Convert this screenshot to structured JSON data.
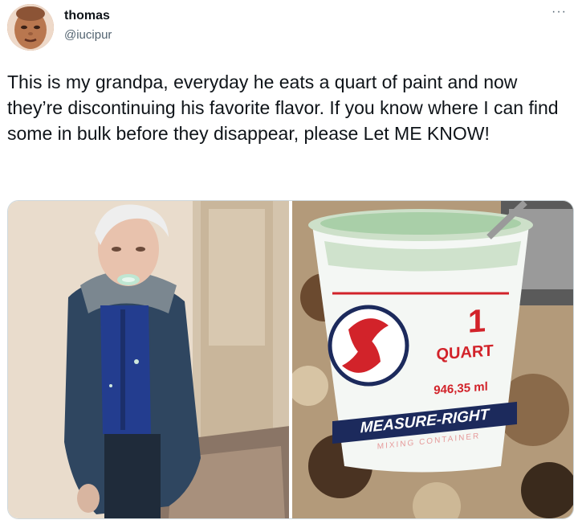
{
  "tweet": {
    "display_name": "thomas",
    "handle": "@iucipur",
    "more_label": "···",
    "text": "This is my grandpa, everyday he eats a quart of paint and now they’re discontinuing his favorite flavor. If you know where I can find some in bulk before they disappear, please Let ME KNOW!"
  },
  "media": {
    "photos": [
      {
        "name": "grandpa-photo"
      },
      {
        "name": "paint-bucket-photo",
        "label_number": "1",
        "label_unit": "QUART",
        "label_volume": "946,35 ml",
        "brand": "MEASURE-RIGHT",
        "sub_text": "MIXING CONTAINER"
      }
    ]
  },
  "colors": {
    "text": "#0f1419",
    "secondary": "#536471",
    "paint": "#a9cfa8",
    "label_red": "#d2232a",
    "label_navy": "#1c2a5c"
  }
}
